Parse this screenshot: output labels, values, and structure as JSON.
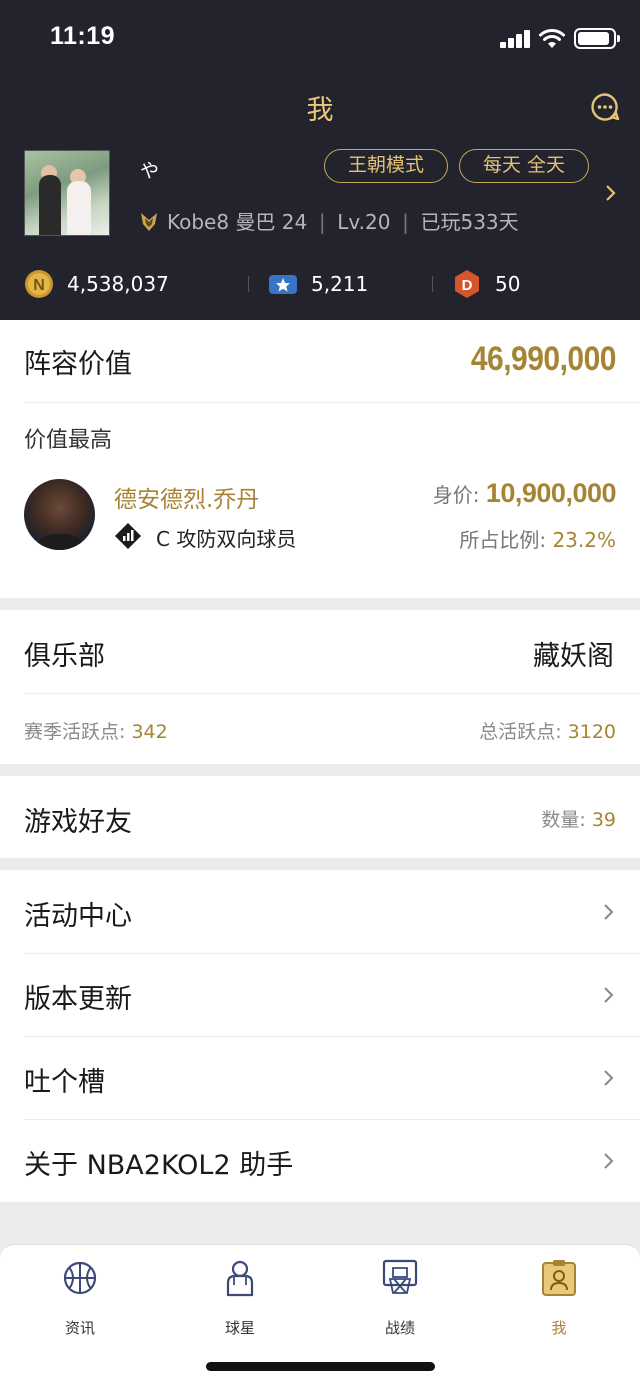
{
  "status": {
    "time": "11:19",
    "battery_level": 0.9
  },
  "header": {
    "title": "我",
    "nickname": "や",
    "mode_tag": "王朝模式",
    "time_tag": "每天 全天",
    "rank_name": "Kobe8 曼巴 24",
    "level": "Lv.20",
    "days_played": "已玩533天",
    "currencies": [
      {
        "icon": "gold-coin-icon",
        "value": "4,538,037"
      },
      {
        "icon": "star-ticket-icon",
        "value": "5,211"
      },
      {
        "icon": "d-badge-icon",
        "value": "50"
      }
    ]
  },
  "lineup": {
    "title": "阵容价值",
    "value": "46,990,000",
    "highest_label": "价值最高",
    "player": {
      "name": "德安德烈.乔丹",
      "position": "C 攻防双向球员",
      "price_label": "身价: ",
      "price": "10,900,000",
      "ratio_label": "所占比例: ",
      "ratio": "23.2%"
    }
  },
  "club": {
    "title": "俱乐部",
    "name": "藏妖阁",
    "season_label": "赛季活跃点: ",
    "season_value": "342",
    "total_label": "总活跃点: ",
    "total_value": "3120"
  },
  "friends": {
    "title": "游戏好友",
    "count_label": "数量: ",
    "count": "39"
  },
  "menu": [
    {
      "label": "活动中心"
    },
    {
      "label": "版本更新"
    },
    {
      "label": "吐个槽"
    },
    {
      "label": "关于 NBA2KOL2 助手"
    }
  ],
  "tabs": [
    {
      "label": "资讯",
      "icon": "basketball-icon",
      "active": false
    },
    {
      "label": "球星",
      "icon": "player-icon",
      "active": false
    },
    {
      "label": "战绩",
      "icon": "hoop-icon",
      "active": false
    },
    {
      "label": "我",
      "icon": "profile-card-icon",
      "active": true
    }
  ],
  "colors": {
    "header_bg": "#23232d",
    "gold": "#a68434",
    "gold_light": "#e9c979"
  }
}
